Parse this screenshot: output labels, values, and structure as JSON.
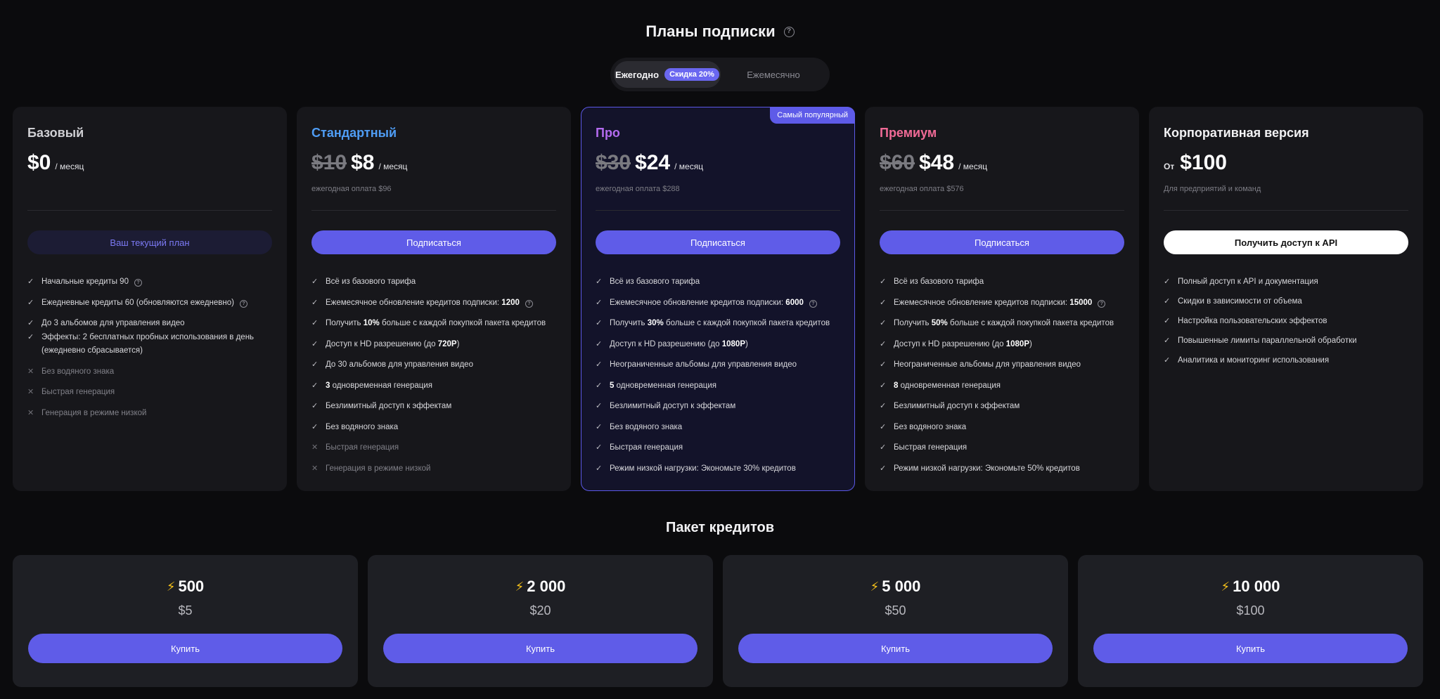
{
  "header": {
    "title": "Планы подписки"
  },
  "billing": {
    "annual": "Ежегодно",
    "discount": "Скидка 20%",
    "monthly": "Ежемесячно"
  },
  "plans": {
    "basic": {
      "name": "Базовый",
      "price": "$0",
      "per": "/ месяц",
      "button": "Ваш текущий план",
      "features": {
        "f0": "Начальные кредиты 90",
        "f1": "Ежедневные кредиты 60 (обновляются ежедневно)",
        "f2": "До 3 альбомов для управления видео",
        "f3": "Эффекты: 2 бесплатных пробных использования в день (ежедневно сбрасывается)",
        "f4": "Без водяного знака",
        "f5": "Быстрая генерация",
        "f6": "Генерация в режиме низкой"
      }
    },
    "standard": {
      "name": "Стандартный",
      "old_price": "$10",
      "price": "$8",
      "per": "/ месяц",
      "billed": "ежегодная оплата $96",
      "button": "Подписаться",
      "features": {
        "f0": "Всё из базового тарифа",
        "f1a": "Ежемесячное обновление кредитов подписки: ",
        "f1b": "1200",
        "f2a": "Получить ",
        "f2b": "10%",
        "f2c": " больше с каждой покупкой пакета кредитов",
        "f3a": "Доступ к HD разрешению (до ",
        "f3b": "720P",
        "f3c": ")",
        "f4": "До 30 альбомов для управления видео",
        "f5a": "3",
        "f5b": " одновременная генерация",
        "f6": "Безлимитный доступ к эффектам",
        "f7": "Без водяного знака",
        "f8": "Быстрая генерация",
        "f9": "Генерация в режиме низкой"
      }
    },
    "pro": {
      "badge": "Самый популярный",
      "name": "Про",
      "old_price": "$30",
      "price": "$24",
      "per": "/ месяц",
      "billed": "ежегодная оплата $288",
      "button": "Подписаться",
      "features": {
        "f0": "Всё из базового тарифа",
        "f1a": "Ежемесячное обновление кредитов подписки: ",
        "f1b": "6000",
        "f2a": "Получить ",
        "f2b": "30%",
        "f2c": " больше с каждой покупкой пакета кредитов",
        "f3a": "Доступ к HD разрешению (до ",
        "f3b": "1080P",
        "f3c": ")",
        "f4": "Неограниченные альбомы для управления видео",
        "f5a": "5",
        "f5b": " одновременная генерация",
        "f6": "Безлимитный доступ к эффектам",
        "f7": "Без водяного знака",
        "f8": "Быстрая генерация",
        "f9": "Режим низкой нагрузки: Экономьте 30% кредитов"
      }
    },
    "premium": {
      "name": "Премиум",
      "old_price": "$60",
      "price": "$48",
      "per": "/ месяц",
      "billed": "ежегодная оплата $576",
      "button": "Подписаться",
      "features": {
        "f0": "Всё из базового тарифа",
        "f1a": "Ежемесячное обновление кредитов подписки: ",
        "f1b": "15000",
        "f2a": "Получить ",
        "f2b": "50%",
        "f2c": " больше с каждой покупкой пакета кредитов",
        "f3a": "Доступ к HD разрешению (до ",
        "f3b": "1080P",
        "f3c": ")",
        "f4": "Неограниченные альбомы для управления видео",
        "f5a": "8",
        "f5b": " одновременная генерация",
        "f6": "Безлимитный доступ к эффектам",
        "f7": "Без водяного знака",
        "f8": "Быстрая генерация",
        "f9": "Режим низкой нагрузки: Экономьте 50% кредитов"
      }
    },
    "enterprise": {
      "name": "Корпоративная версия",
      "from": "От",
      "price": "$100",
      "note": "Для предприятий и команд",
      "button": "Получить доступ к API",
      "features": {
        "f0": "Полный доступ к API и документация",
        "f1": "Скидки в зависимости от объема",
        "f2": "Настройка пользовательских эффектов",
        "f3": "Повышенные лимиты параллельной обработки",
        "f4": "Аналитика и мониторинг использования"
      }
    }
  },
  "credits": {
    "title": "Пакет кредитов",
    "buy": "Купить",
    "packs": [
      {
        "amount": "500",
        "price": "$5"
      },
      {
        "amount": "2 000",
        "price": "$20"
      },
      {
        "amount": "5 000",
        "price": "$50"
      },
      {
        "amount": "10 000",
        "price": "$100"
      }
    ]
  },
  "icons": {
    "check": "check-icon",
    "cross": "cross-icon",
    "help": "help-icon",
    "bolt": "lightning-icon"
  },
  "colors": {
    "accent": "#5f5ce8",
    "standard": "#4f9df5",
    "pro": "#b46bf0",
    "premium": "#f06a96",
    "bolt": "#f7c21a"
  }
}
